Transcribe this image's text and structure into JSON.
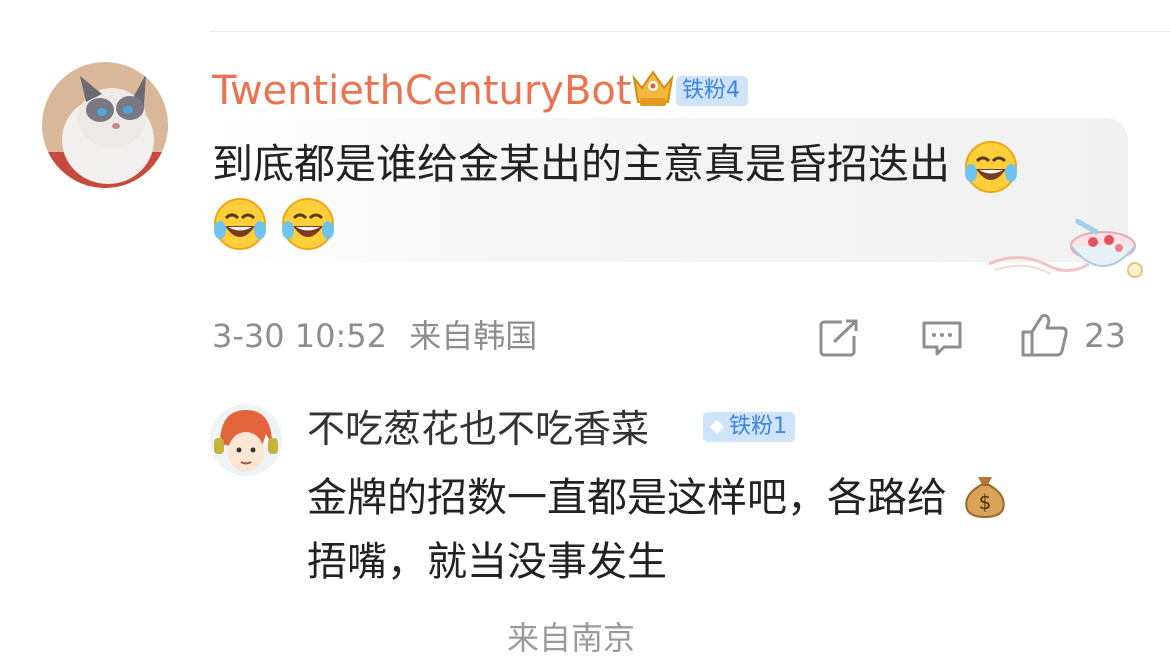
{
  "comment": {
    "username": "TwentiethCenturyBot",
    "badge": "铁粉4",
    "text": "到底都是谁给金某出的主意真是昏招迭出",
    "emojis": [
      "laughing-crying-emoji",
      "laughing-crying-emoji",
      "laughing-crying-emoji"
    ],
    "timestamp": "3-30 10:52",
    "location": "来自韩国",
    "like_count": "23"
  },
  "reply": {
    "username": "不吃葱花也不吃香菜",
    "badge": "铁粉1",
    "text_line1": "金牌的招数一直都是这样吧，各路给",
    "text_line2": "捂嘴，就当没事发生",
    "emoji": "money-bag-emoji"
  },
  "next_item_partial": {
    "location": "来自南京"
  },
  "colors": {
    "username": "#eb7350",
    "badge_bg": "#cfe3fb",
    "badge_text": "#3a86e0",
    "meta": "#8e8e8e"
  }
}
